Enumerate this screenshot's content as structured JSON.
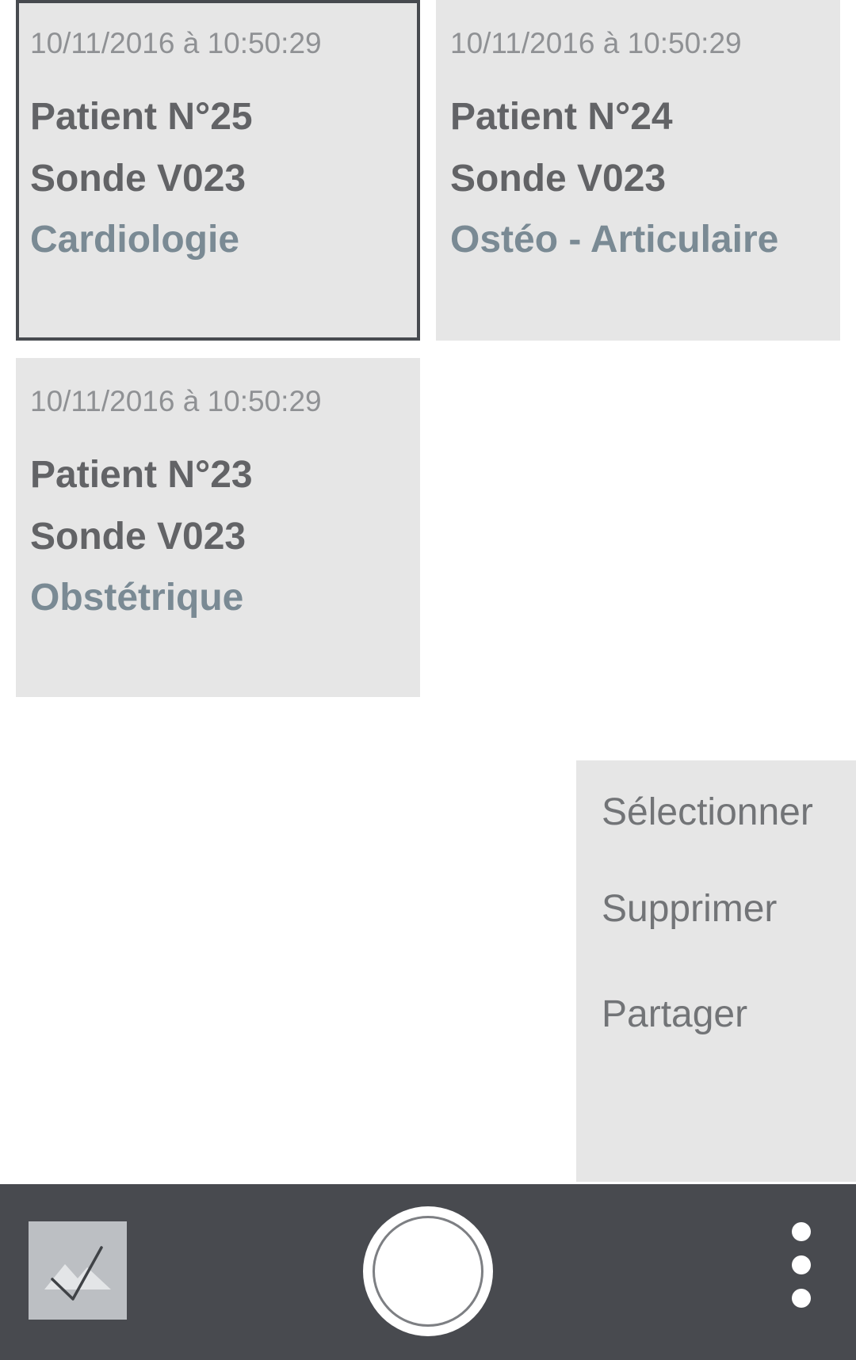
{
  "cards": [
    {
      "date": "10/11/2016 à 10:50:29",
      "patient": "Patient N°25",
      "probe": "Sonde V023",
      "exam": "Cardiologie",
      "selected": true
    },
    {
      "date": "10/11/2016 à 10:50:29",
      "patient": "Patient N°24",
      "probe": "Sonde V023",
      "exam": "Ostéo - Articulaire",
      "selected": false
    },
    {
      "date": "10/11/2016 à 10:50:29",
      "patient": "Patient N°23",
      "probe": "Sonde V023",
      "exam": "Obstétrique",
      "selected": false
    }
  ],
  "menu": {
    "items": [
      "Sélectionner",
      "Supprimer",
      "Partager"
    ]
  },
  "bottom_bar": {
    "gallery_icon": "gallery-check-icon",
    "shutter_icon": "shutter-icon",
    "overflow_icon": "more-vert-icon"
  },
  "colors": {
    "card_bg": "#e6e6e6",
    "selected_border": "#474a4f",
    "exam_text": "#7a8a94",
    "bar_bg": "#484a4f"
  }
}
